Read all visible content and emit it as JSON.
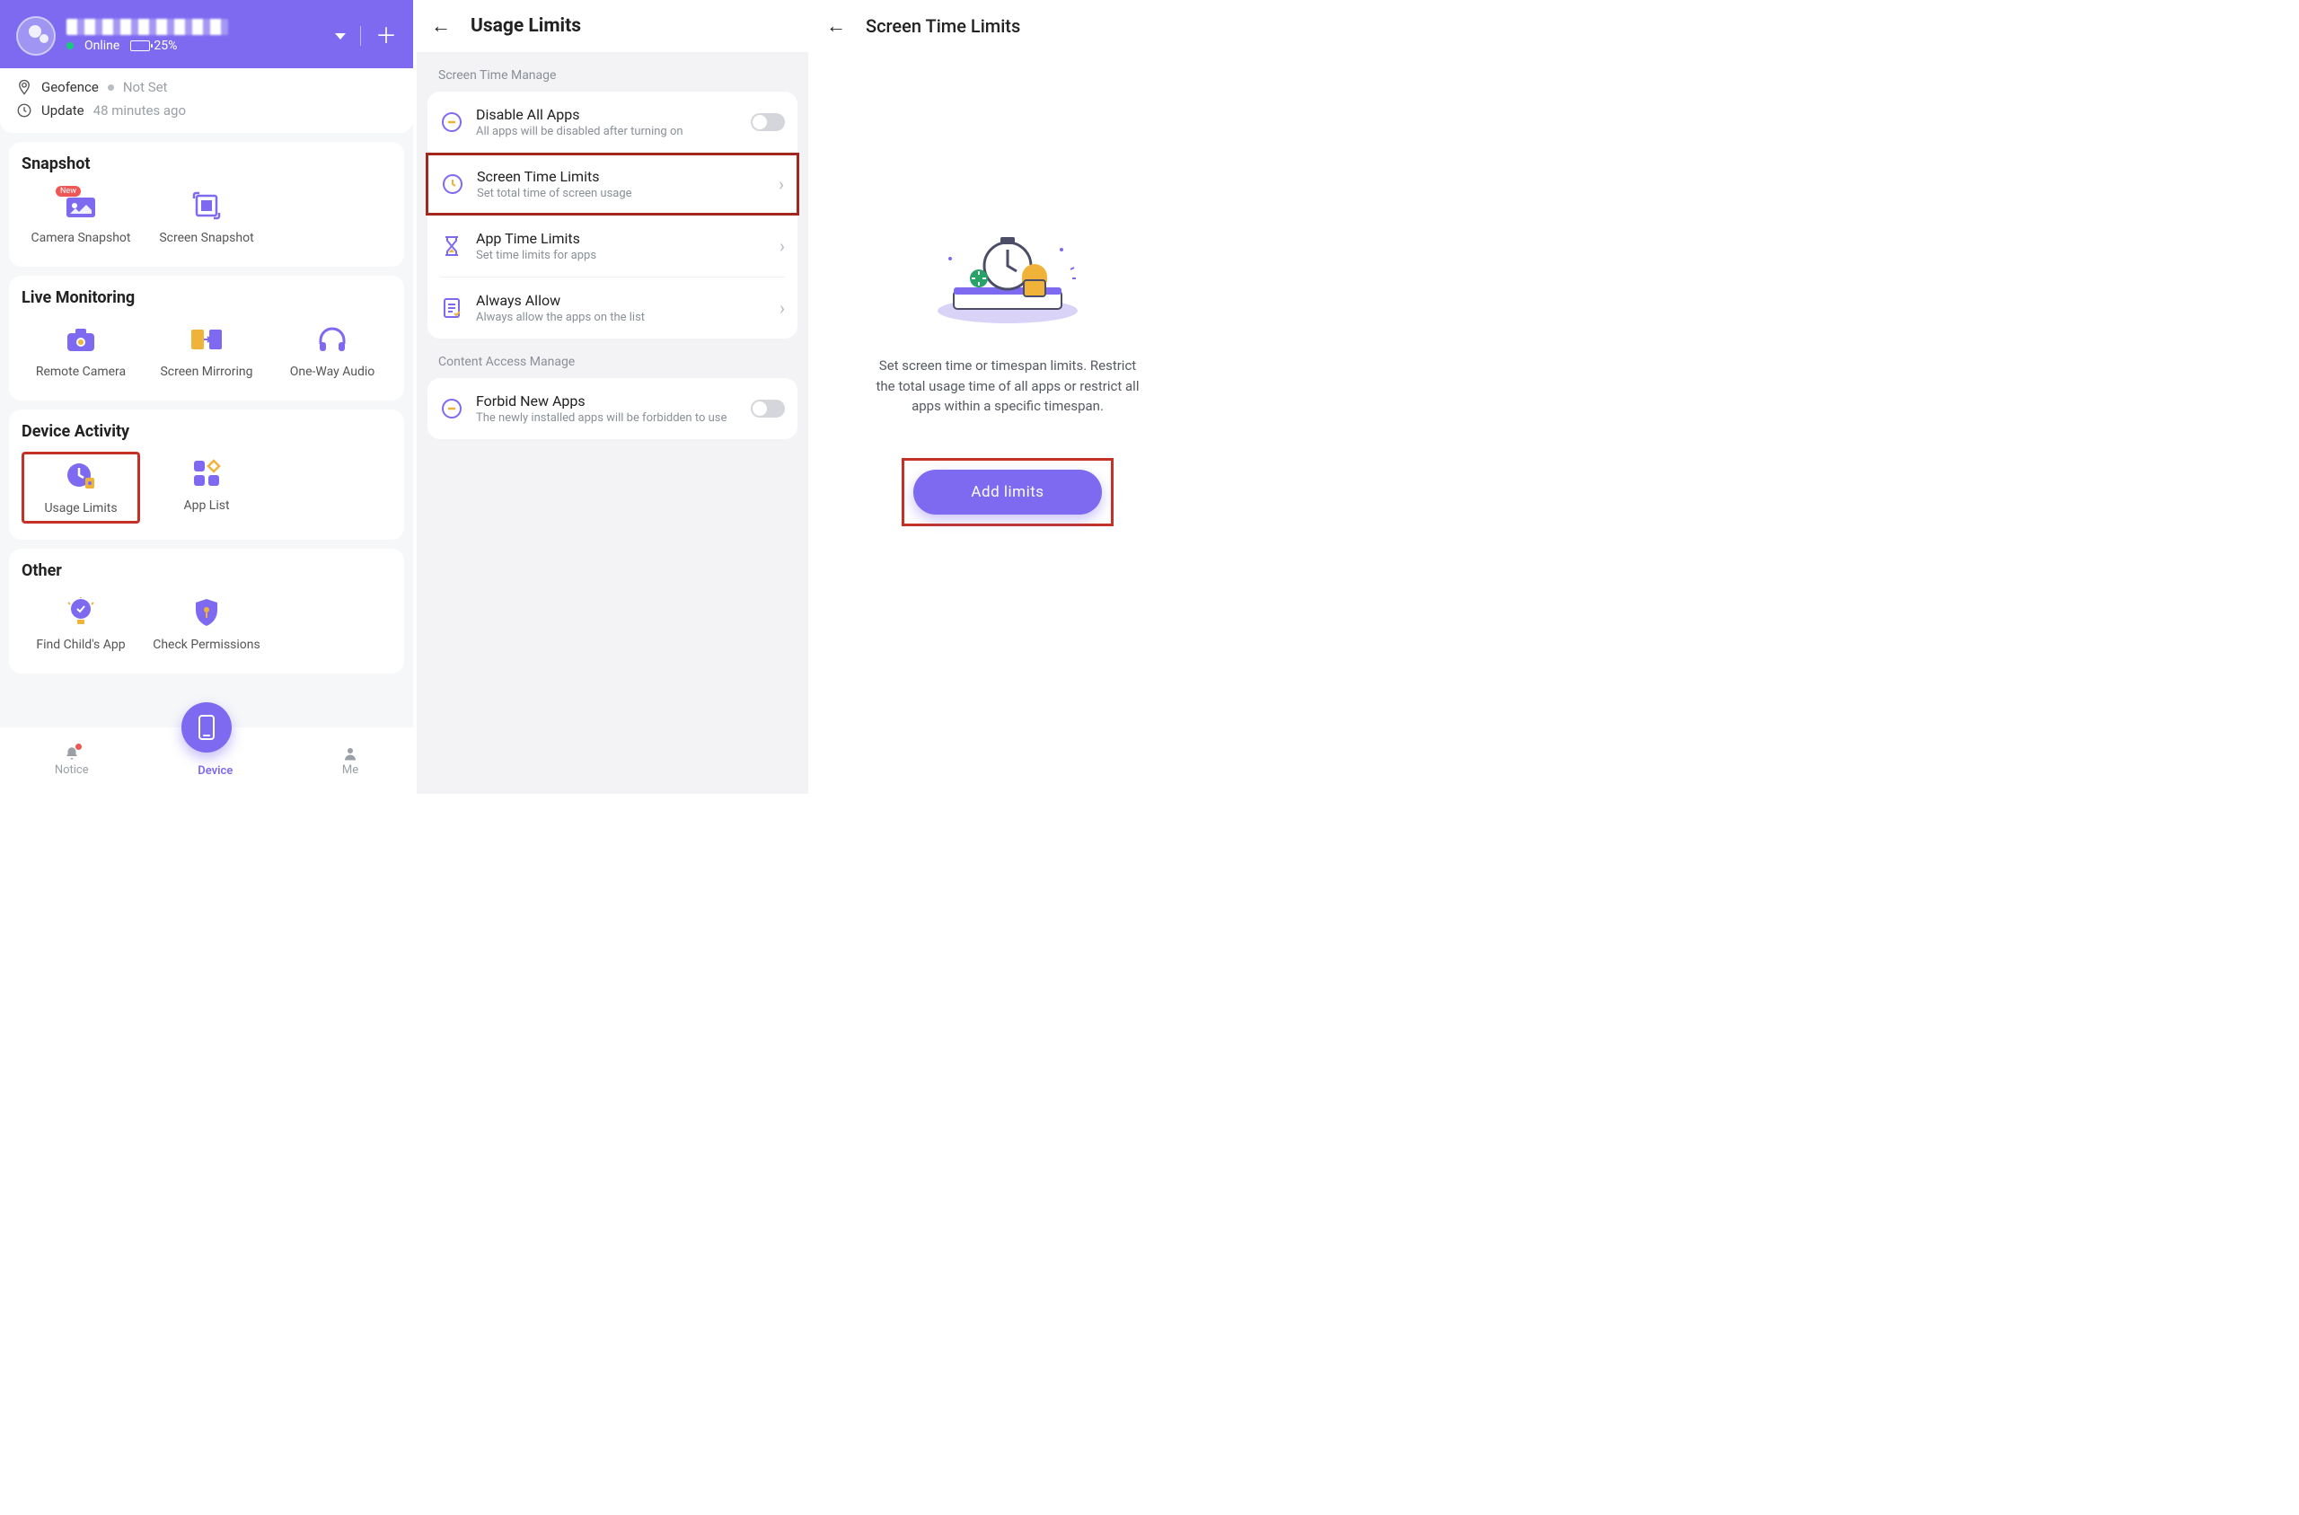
{
  "panel1": {
    "status_online": "Online",
    "battery_pct": "25%",
    "geofence_label": "Geofence",
    "geofence_status": "Not Set",
    "update_label": "Update",
    "update_value": "48 minutes ago",
    "sections": {
      "snapshot": {
        "title": "Snapshot",
        "camera": "Camera Snapshot",
        "screen": "Screen Snapshot"
      },
      "live": {
        "title": "Live Monitoring",
        "remote_camera": "Remote Camera",
        "mirroring": "Screen Mirroring",
        "audio": "One-Way Audio"
      },
      "activity": {
        "title": "Device Activity",
        "usage_limits": "Usage Limits",
        "app_list": "App List"
      },
      "other": {
        "title": "Other",
        "find_childs_app": "Find Child's App",
        "check_perms": "Check Permissions"
      }
    },
    "nav": {
      "notice": "Notice",
      "device": "Device",
      "me": "Me"
    }
  },
  "panel2": {
    "title": "Usage Limits",
    "section_screen": "Screen Time Manage",
    "section_content": "Content Access Manage",
    "disable_all": {
      "title": "Disable All Apps",
      "sub": "All apps will be disabled after turning on"
    },
    "screen_time_limits": {
      "title": "Screen Time Limits",
      "sub": "Set total time of screen usage"
    },
    "app_time_limits": {
      "title": "App Time Limits",
      "sub": "Set time limits for apps"
    },
    "always_allow": {
      "title": "Always Allow",
      "sub": "Always allow the apps on the list"
    },
    "forbid_new": {
      "title": "Forbid New Apps",
      "sub": "The newly installed apps will be forbidden to use"
    }
  },
  "panel3": {
    "title": "Screen Time Limits",
    "desc": "Set screen time or timespan limits. Restrict the total usage time of all apps or restrict all apps within a specific timespan.",
    "cta": "Add limits"
  }
}
